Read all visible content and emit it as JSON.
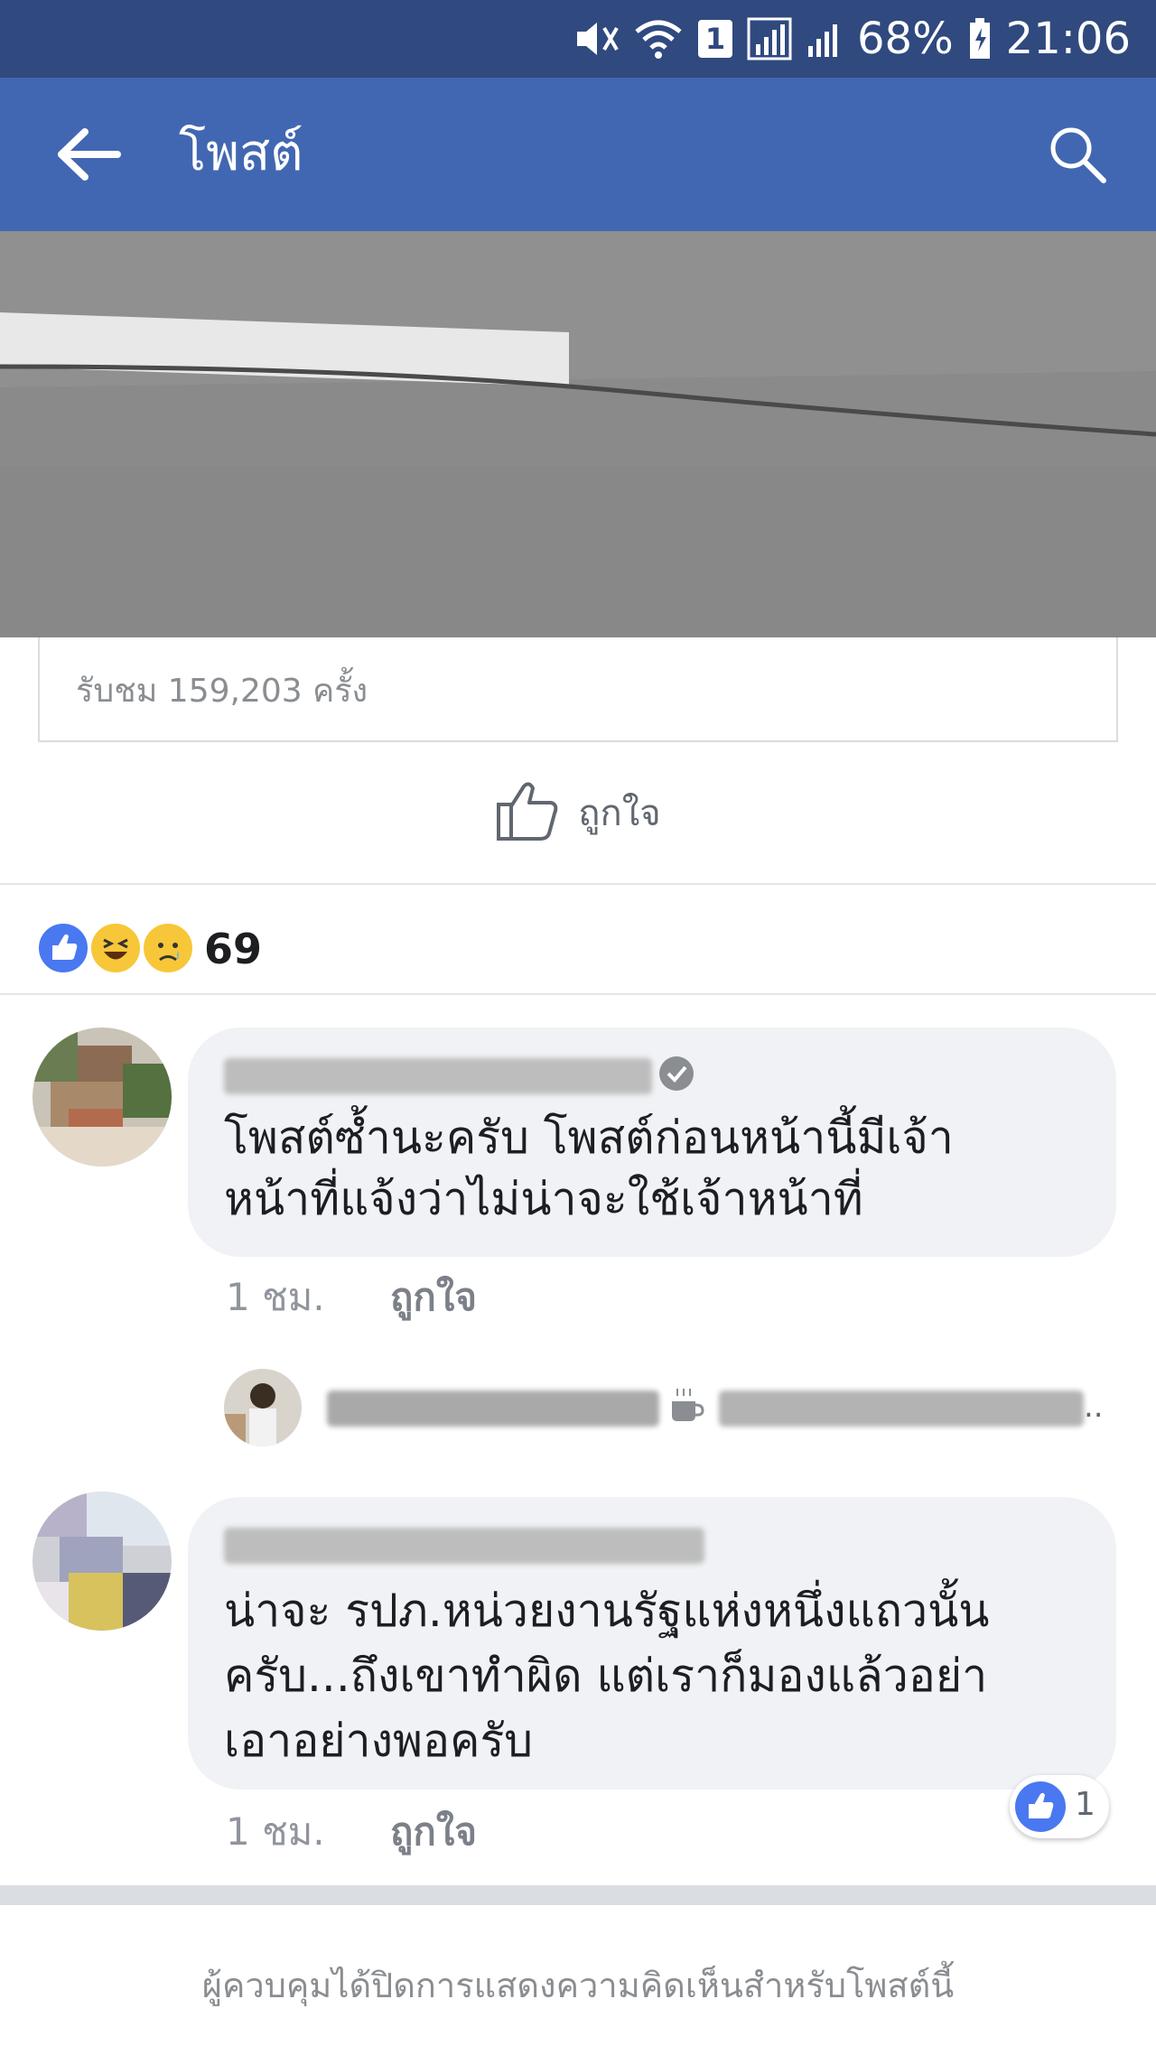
{
  "status_bar": {
    "battery": "68%",
    "time": "21:06",
    "sim_badge": "1"
  },
  "app_bar": {
    "title": "โพสต์"
  },
  "post": {
    "views": "รับชม 159,203 ครั้ง",
    "like_label": "ถูกใจ",
    "reaction_count": "69",
    "reaction_colors": {
      "like": "#4a78f0",
      "haha": "#f7c739",
      "sad": "#f7c739"
    }
  },
  "comments": [
    {
      "text_line1": "โพสต์ซ้ำนะครับ โพสต์ก่อนหน้านี้มีเจ้า",
      "text_line2": "หน้าที่แจ้งว่าไม่น่าจะใช้เจ้าหน้าที่",
      "time": "1 ชม.",
      "like_label": "ถูกใจ"
    },
    {
      "text_line1": "น่าจะ รปภ.หน่วยงานรัฐแห่งหนึ่งแถวนั้น",
      "text_line2": "ครับ...ถึงเขาทำผิด แต่เราก็มองแล้วอย่า",
      "text_line3": "เอาอย่างพอครับ",
      "time": "1 ชม.",
      "like_label": "ถูกใจ",
      "like_count": "1"
    }
  ],
  "reply_preview": {
    "ellipsis": ".."
  },
  "footer": {
    "text": "ผู้ควบคุมได้ปิดการแสดงความคิดเห็นสำหรับโพสต์นี้"
  }
}
